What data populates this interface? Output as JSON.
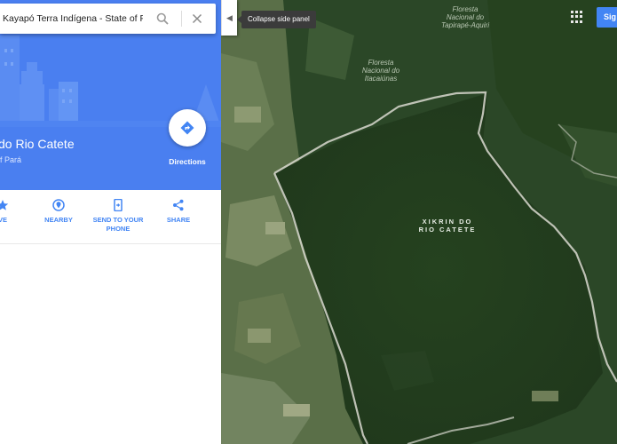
{
  "search": {
    "value": "Kayapó Terra Indígena - State of P"
  },
  "place": {
    "title": "do Rio Catete",
    "subtitle": "f Pará"
  },
  "directions": {
    "label": "Directions"
  },
  "actions": [
    {
      "label": "VE"
    },
    {
      "label": "NEARBY"
    },
    {
      "label": "SEND TO YOUR PHONE",
      "line1": "SEND TO YOUR",
      "line2": "PHONE"
    },
    {
      "label": "SHARE"
    }
  ],
  "map": {
    "collapse_tooltip": "Collapse side panel",
    "labels": {
      "tapirape": {
        "line1": "Floresta",
        "line2": "Nacional do",
        "line3": "Tapirapé-Aquiri"
      },
      "itacaiunas": {
        "line1": "Floresta",
        "line2": "Nacional do",
        "line3": "Itacaiúnas"
      },
      "territory": {
        "line1": "XIKRIN DO",
        "line2": "RIO CATETE"
      }
    },
    "signin_label": "Sig"
  },
  "colors": {
    "accent": "#4285f4",
    "panel_blue": "#4a7ff0",
    "forest": "#2d4a2b",
    "boundary": "#d9d9d0"
  }
}
